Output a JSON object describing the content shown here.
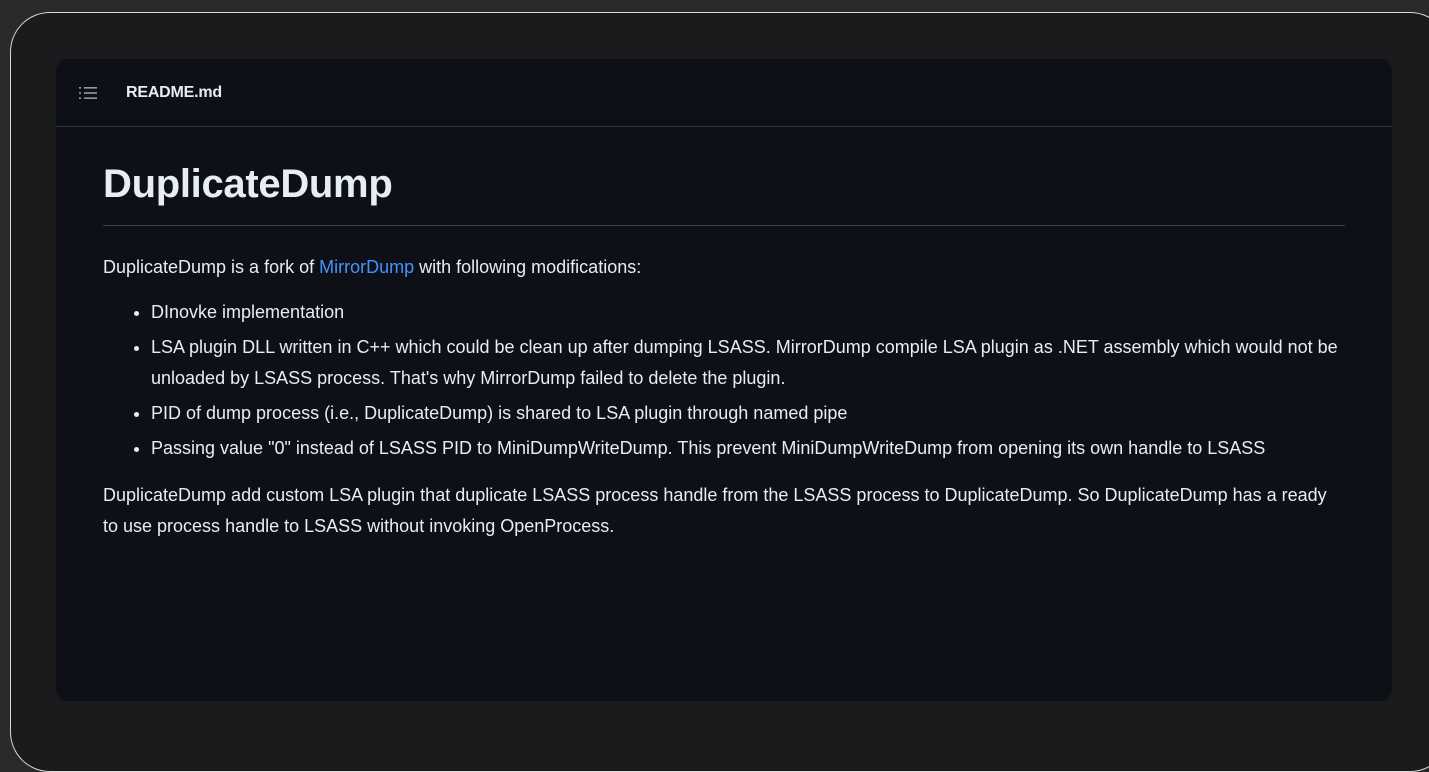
{
  "readme": {
    "file_name": "README.md",
    "title": "DuplicateDump",
    "intro_before_link": "DuplicateDump is a fork of ",
    "intro_link": "MirrorDump",
    "intro_after_link": " with following modifications:",
    "modifications": [
      "DInovke implementation",
      "LSA plugin DLL written in C++ which could be clean up after dumping LSASS. MirrorDump compile LSA plugin as .NET assembly which would not be unloaded by LSASS process. That's why MirrorDump failed to delete the plugin.",
      "PID of dump process (i.e., DuplicateDump) is shared to LSA plugin through named pipe",
      "Passing value \"0\" instead of LSASS PID to MiniDumpWriteDump. This prevent MiniDumpWriteDump from opening its own handle to LSASS"
    ],
    "outro": "DuplicateDump add custom LSA plugin that duplicate LSASS process handle from the LSASS process to DuplicateDump. So DuplicateDump has a ready to use process handle to LSASS without invoking OpenProcess."
  },
  "icons": {
    "header_icon": "list-unordered-icon"
  },
  "colors": {
    "background": "#0d1117",
    "text": "#e6edf3",
    "link": "#4493f8",
    "divider": "#30363d"
  }
}
